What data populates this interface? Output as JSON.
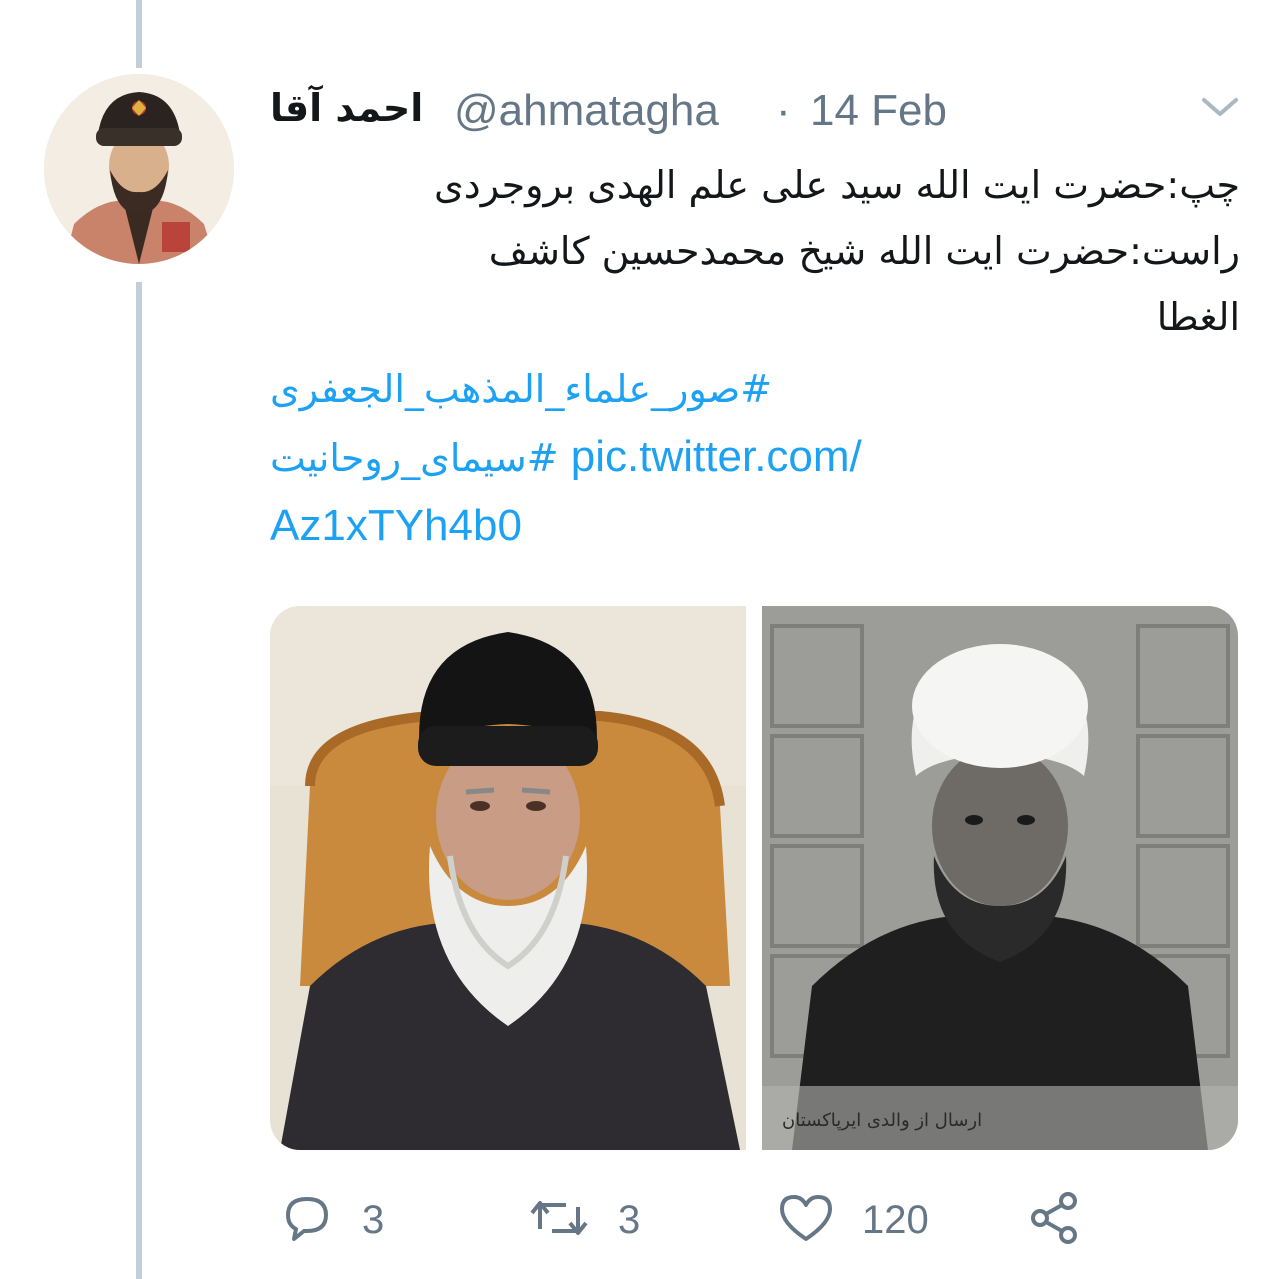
{
  "tweet": {
    "author": {
      "display_name": "احمد آقا",
      "handle": "@ahmatagha",
      "separator": "·",
      "date": "14 Feb"
    },
    "text_lines": [
      "چپ:حضرت ایت الله سید علی علم الهدی بروجردی",
      "راست:حضرت ایت الله شیخ محمدحسین کاشف",
      "الغطا"
    ],
    "hashtag_1": "#صور_علماء_المذهب_الجعفری",
    "hashtag_2": "#سیمای_روحانیت",
    "link_part_1": "pic.twitter.com/",
    "link_part_2": "Az1xTYh4b0",
    "media_caption_handwritten": "ارسال از والدی ایرپاکستان",
    "actions": {
      "reply_count": "3",
      "retweet_count": "3",
      "like_count": "120"
    }
  },
  "colors": {
    "link": "#1da1f2",
    "secondary_text": "#657786",
    "primary_text": "#14171a",
    "thread_line": "#c4ced6"
  },
  "icons": [
    "chevron-down-icon",
    "reply-icon",
    "retweet-icon",
    "heart-icon",
    "share-icon"
  ]
}
